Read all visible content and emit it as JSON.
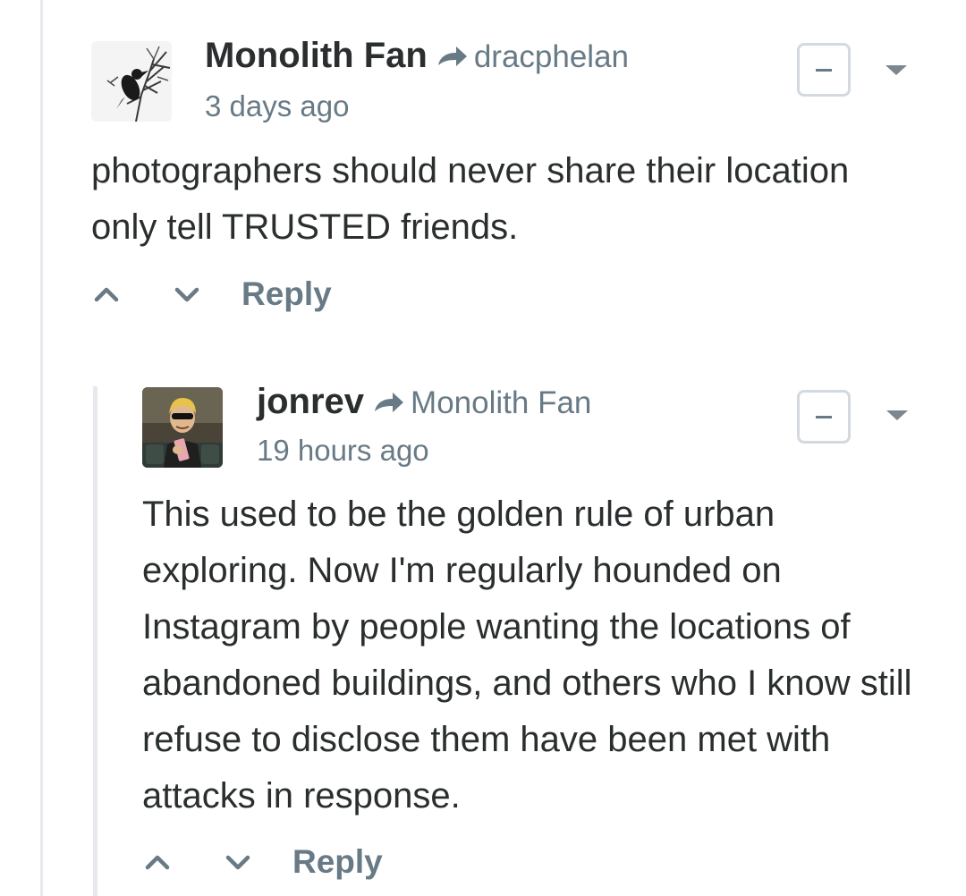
{
  "comments": [
    {
      "author": "Monolith Fan",
      "parent_author": "dracphelan",
      "timestamp": "3 days ago",
      "body": "photographers should never share their location only tell TRUSTED friends.",
      "reply_label": "Reply",
      "avatar_icon": "crow-on-branch-avatar"
    },
    {
      "author": "jonrev",
      "parent_author": "Monolith Fan",
      "timestamp": "19 hours ago",
      "body": "This used to be the golden rule of urban exploring. Now I'm regularly hounded on Instagram by people wanting the locations of abandoned buildings, and others who I know still refuse to disclose them have been met with attacks in response.",
      "reply_label": "Reply",
      "avatar_icon": "man-with-sunglasses-avatar"
    }
  ],
  "colors": {
    "text": "#2a2e2e",
    "muted": "#687a86",
    "border": "#d3d9de",
    "thread_line": "#e7e9ee"
  }
}
